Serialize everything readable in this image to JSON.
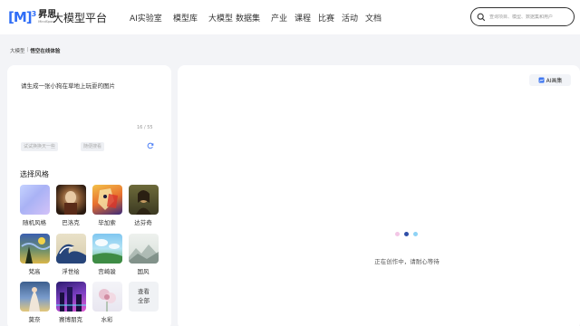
{
  "header": {
    "logo_mark": "M",
    "logo_sup": "3",
    "logo_name": "昇思",
    "logo_sub": "MindSpore",
    "site_title": "大模型平台",
    "nav": [
      "AI实验室",
      "模型库",
      "大模型",
      "数据集",
      "产业",
      "课程",
      "比赛",
      "活动",
      "文档"
    ],
    "search_placeholder": "查询项目、模型、数据集和用户"
  },
  "breadcrumb": {
    "root": "大模型",
    "sep": "|",
    "current": "悟空在线体验"
  },
  "prompt": {
    "text": "请生成一张小狗在草地上玩耍的图片",
    "count": "16 / 55",
    "tags": [
      "试试换换天一些",
      "随便搜看"
    ]
  },
  "styles": {
    "heading": "选择风格",
    "items": [
      {
        "label": "随机风格"
      },
      {
        "label": "巴洛克"
      },
      {
        "label": "毕加索"
      },
      {
        "label": "达芬奇"
      },
      {
        "label": "梵高"
      },
      {
        "label": "浮世绘"
      },
      {
        "label": "宫崎骏"
      },
      {
        "label": "国风"
      },
      {
        "label": "莫奈"
      },
      {
        "label": "赛博朋克"
      },
      {
        "label": "水彩"
      }
    ],
    "view_all_line1": "查看",
    "view_all_line2": "全部"
  },
  "canvas": {
    "ai_pic_label": "AI画集",
    "loading_text": "正在创作中，请耐心等待"
  }
}
